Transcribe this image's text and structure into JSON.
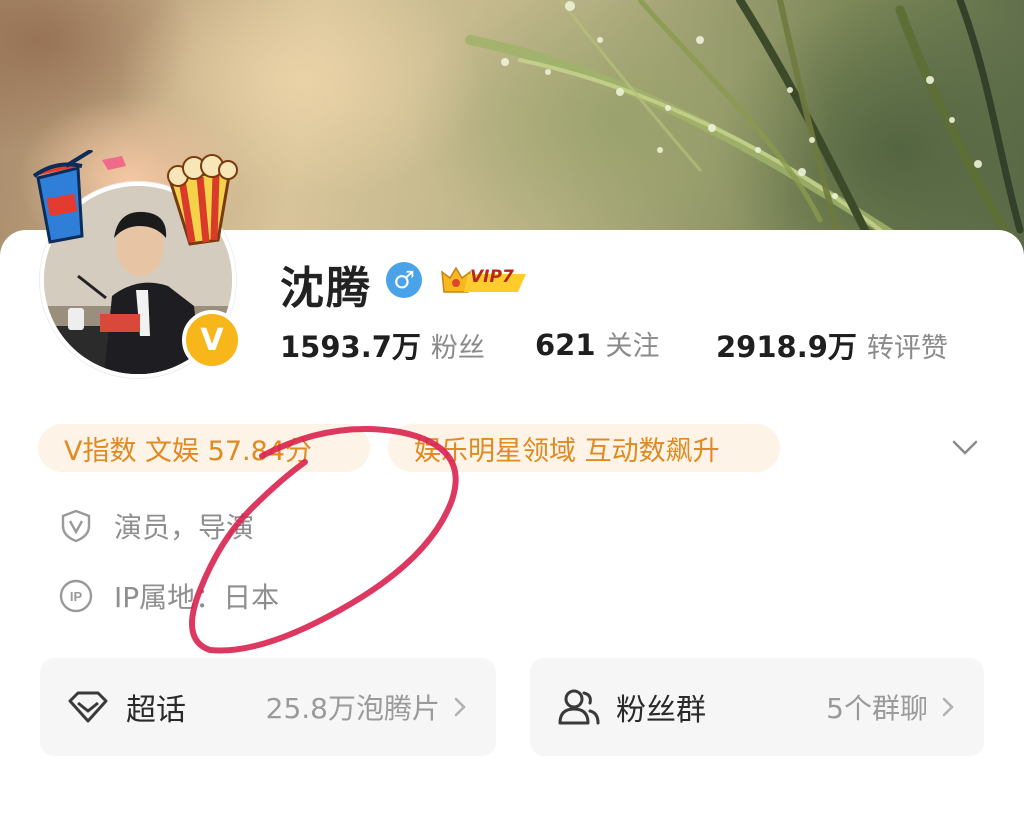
{
  "profile": {
    "name": "沈腾",
    "gender_symbol": "♂",
    "vip_label": "VIP7",
    "verified_badge": "V"
  },
  "stats": [
    {
      "value": "1593.7万",
      "label": "粉丝"
    },
    {
      "value": "621",
      "label": "关注"
    },
    {
      "value": "2918.9万",
      "label": "转评赞"
    }
  ],
  "pills": [
    "V指数 文娱 57.84分",
    "娱乐明星领域 互动数飙升"
  ],
  "info": {
    "occupation": "演员，导演",
    "ip_location": "IP属地：日本"
  },
  "tiles": [
    {
      "label": "超话",
      "value": "25.8万泡腾片"
    },
    {
      "label": "粉丝群",
      "value": "5个群聊"
    }
  ],
  "icons": {
    "occupation": "shield-v-icon",
    "ip": "ip-circle-icon",
    "super_topic": "diamond-icon",
    "fan_group": "people-icon",
    "expand": "chevron-down-icon"
  },
  "colors": {
    "accent_orange": "#e08a20",
    "pill_bg": "#fdf3e7",
    "vip_gold": "#f5b81f",
    "gender_blue": "#4aa3e8",
    "annotation_red": "#d9224e"
  }
}
